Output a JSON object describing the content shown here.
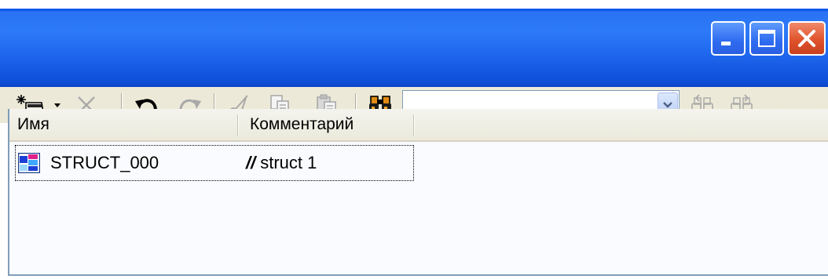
{
  "window": {
    "buttons": {
      "minimize": "minimize-icon",
      "maximize": "maximize-icon",
      "close": "close-icon"
    }
  },
  "toolbar": {
    "icons": [
      "new-item-icon",
      "dropdown-arrow-icon",
      "delete-icon",
      "undo-icon",
      "redo-icon",
      "cut-icon",
      "copy-icon",
      "paste-icon",
      "find-icon",
      "find-previous-icon",
      "find-next-icon"
    ],
    "search": {
      "value": "",
      "placeholder": ""
    }
  },
  "list": {
    "columns": [
      "Имя",
      "Комментарий"
    ],
    "rows": [
      {
        "icon": "struct-icon",
        "name": "STRUCT_000",
        "comment_prefix": "//",
        "comment": "struct 1"
      }
    ]
  },
  "colors": {
    "title_bar": "#2d7af8",
    "toolbar_bg": "#ece9d8",
    "close_button": "#e0532c",
    "list_bg": "#fafbff",
    "border": "#7f9db9"
  }
}
